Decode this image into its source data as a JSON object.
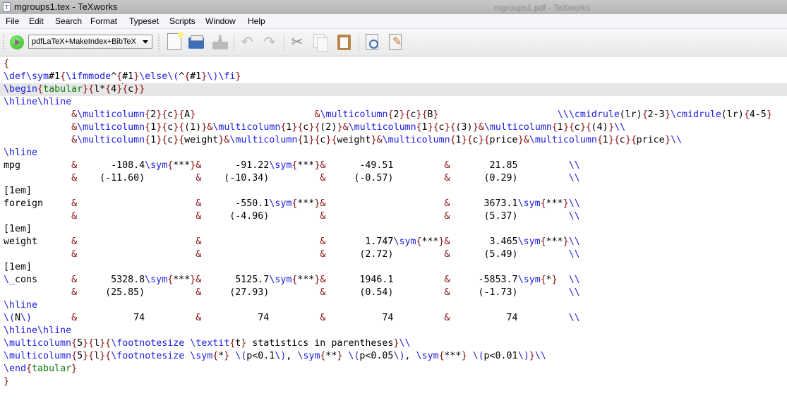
{
  "window": {
    "title": "mgroups1.tex - TeXworks",
    "background_window_title": "mgroups1.pdf - TeXworks",
    "doc_icon_letter": "T"
  },
  "menu": [
    "File",
    "Edit",
    "Search",
    "Format",
    "Typeset",
    "Scripts",
    "Window",
    "Help"
  ],
  "toolbar": {
    "typeset_engine": "pdfLaTeX+MakeIndex+BibTeX",
    "icons": [
      "typeset-run-icon",
      "new-document-icon",
      "open-folder-icon",
      "save-icon",
      "undo-icon",
      "redo-icon",
      "cut-icon",
      "copy-icon",
      "paste-icon",
      "find-icon",
      "replace-icon"
    ]
  },
  "colors": {
    "command": "#1d1de0",
    "brace": "#8b1010",
    "environment": "#0a7a0a",
    "current_line": "#e6e6e6"
  },
  "editor": {
    "current_line": 2,
    "cursor_after": "\\begin{tabular}{l*{4}",
    "lines": [
      "{",
      "\\def\\sym#1{\\ifmmode^{#1}\\else\\(^{#1}\\)\\fi}",
      "\\begin{tabular}{l*{4}{c}}",
      "\\hline\\hline",
      "            &\\multicolumn{2}{c}{A}                     &\\multicolumn{2}{c}{B}                     \\\\\\cmidrule(lr){2-3}\\cmidrule(lr){4-5}",
      "            &\\multicolumn{1}{c}{(1)}&\\multicolumn{1}{c}{(2)}&\\multicolumn{1}{c}{(3)}&\\multicolumn{1}{c}{(4)}\\\\",
      "            &\\multicolumn{1}{c}{weight}&\\multicolumn{1}{c}{weight}&\\multicolumn{1}{c}{price}&\\multicolumn{1}{c}{price}\\\\",
      "\\hline",
      "mpg         &      -108.4\\sym{***}&      -91.22\\sym{***}&      -49.51         &       21.85         \\\\",
      "            &    (-11.60)         &    (-10.34)         &     (-0.57)         &      (0.29)         \\\\",
      "[1em]",
      "foreign     &                     &      -550.1\\sym{***}&                     &      3673.1\\sym{***}\\\\",
      "            &                     &     (-4.96)         &                     &      (5.37)         \\\\",
      "[1em]",
      "weight      &                     &                     &       1.747\\sym{***}&       3.465\\sym{***}\\\\",
      "            &                     &                     &      (2.72)         &      (5.49)         \\\\",
      "[1em]",
      "\\_cons      &      5328.8\\sym{***}&      5125.7\\sym{***}&      1946.1         &     -5853.7\\sym{*}  \\\\",
      "            &     (25.85)         &     (27.93)         &      (0.54)         &     (-1.73)         \\\\",
      "\\hline",
      "\\(N\\)       &          74         &          74         &          74         &          74         \\\\",
      "\\hline\\hline",
      "\\multicolumn{5}{l}{\\footnotesize \\textit{t} statistics in parentheses}\\\\",
      "\\multicolumn{5}{l}{\\footnotesize \\sym{*} \\(p<0.1\\), \\sym{**} \\(p<0.05\\), \\sym{***} \\(p<0.01\\)}\\\\",
      "\\end{tabular}",
      "}"
    ]
  }
}
